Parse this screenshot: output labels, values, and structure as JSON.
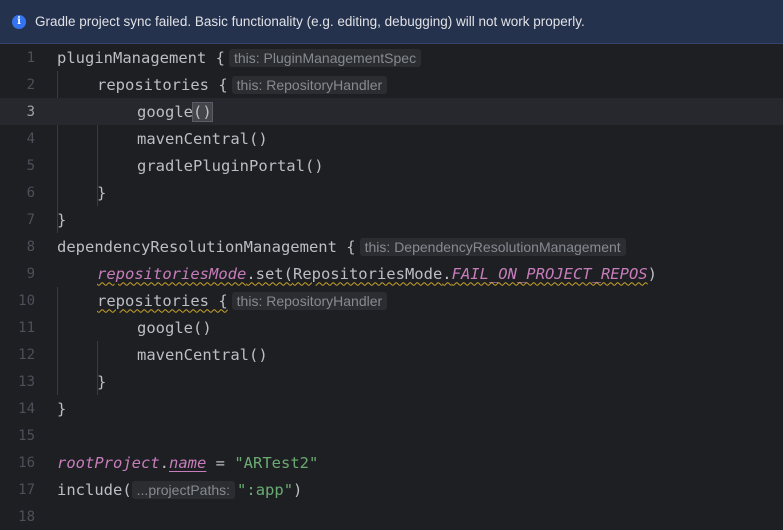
{
  "banner": {
    "icon": "info-icon",
    "message": "Gradle project sync failed. Basic functionality (e.g. editing, debugging) will not work properly."
  },
  "lines": [
    {
      "number": "1",
      "parts": [
        "pluginManagement {"
      ],
      "hint": "this: PluginManagementSpec"
    },
    {
      "number": "2",
      "parts": [
        "repositories {"
      ],
      "hint": "this: RepositoryHandler"
    },
    {
      "number": "3",
      "parts": [
        "google",
        "()"
      ]
    },
    {
      "number": "4",
      "parts": [
        "mavenCentral()"
      ]
    },
    {
      "number": "5",
      "parts": [
        "gradlePluginPortal()"
      ]
    },
    {
      "number": "6",
      "parts": [
        "}"
      ]
    },
    {
      "number": "7",
      "parts": [
        "}"
      ]
    },
    {
      "number": "8",
      "parts": [
        "dependencyResolutionManagement {"
      ],
      "hint": "this: DependencyResolutionManagement"
    },
    {
      "number": "9",
      "parts": [
        "repositoriesMode",
        ".set(",
        "RepositoriesMode",
        ".",
        "FAIL_ON_PROJECT_REPOS",
        ")"
      ]
    },
    {
      "number": "10",
      "parts": [
        "repositories {"
      ],
      "hint": "this: RepositoryHandler"
    },
    {
      "number": "11",
      "parts": [
        "google()"
      ]
    },
    {
      "number": "12",
      "parts": [
        "mavenCentral()"
      ]
    },
    {
      "number": "13",
      "parts": [
        "}"
      ]
    },
    {
      "number": "14",
      "parts": [
        "}"
      ]
    },
    {
      "number": "15",
      "parts": [
        ""
      ]
    },
    {
      "number": "16",
      "parts": [
        "rootProject",
        ".",
        "name",
        " = ",
        "\"ARTest2\""
      ]
    },
    {
      "number": "17",
      "parts": [
        "include(",
        "...projectPaths:",
        "\":app\"",
        ")"
      ]
    },
    {
      "number": "18",
      "parts": [
        ""
      ]
    }
  ],
  "current_line": "3",
  "colors": {
    "background": "#1e1f22",
    "banner": "#25324d",
    "text": "#bcbec4",
    "property": "#c77dbb",
    "string": "#6aab73",
    "warning_squiggle": "#c9a42a"
  }
}
